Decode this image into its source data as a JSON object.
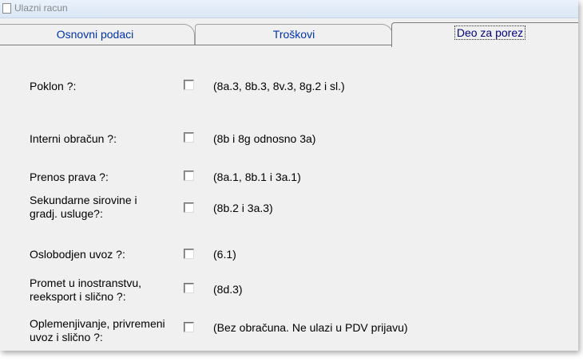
{
  "window": {
    "title": "Ulazni racun",
    "app_icon": "document-icon"
  },
  "tabs": [
    {
      "label": "Osnovni podaci",
      "selected": false
    },
    {
      "label": "Troškovi",
      "selected": false
    },
    {
      "label": "Deo za porez",
      "selected": true
    }
  ],
  "fields": [
    {
      "label": "Poklon ?:",
      "hint": "(8a.3, 8b.3, 8v.3, 8g.2 i sl.)",
      "checked": false
    },
    {
      "label": "Interni obračun ?:",
      "hint": "(8b i 8g odnosno 3a)",
      "checked": false
    },
    {
      "label": "Prenos prava ?:",
      "hint": "(8a.1, 8b.1 i 3a.1)",
      "checked": false
    },
    {
      "label_lines": [
        "Sekundarne sirovine i",
        "gradj. usluge?:"
      ],
      "hint": "(8b.2 i 3a.3)",
      "checked": false
    },
    {
      "label": "Oslobodjen uvoz ?:",
      "hint": "(6.1)",
      "checked": false
    },
    {
      "label_lines": [
        "Promet u inostranstvu,",
        "reeksport i slično ?:"
      ],
      "hint": "(8d.3)",
      "checked": false
    },
    {
      "label_lines": [
        "Oplemenjivanje, privremeni",
        "uvoz i slično ?:"
      ],
      "hint": "(Bez obračuna. Ne ulazi u PDV prijavu)",
      "checked": false
    }
  ]
}
